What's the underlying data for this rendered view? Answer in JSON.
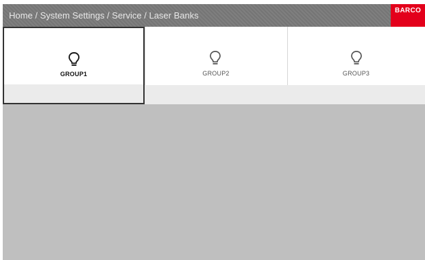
{
  "header": {
    "breadcrumb": "Home / System Settings / Service / Laser Banks",
    "logo_text": "BARCO",
    "logo_color": "#e3001b",
    "background_color": "#7a7a7a"
  },
  "groups": [
    {
      "label": "GROUP1",
      "icon": "lightbulb-icon",
      "selected": true
    },
    {
      "label": "GROUP2",
      "icon": "lightbulb-icon",
      "selected": false
    },
    {
      "label": "GROUP3",
      "icon": "lightbulb-icon",
      "selected": false
    }
  ],
  "colors": {
    "content_background": "#bfbfbf",
    "tile_background": "#ffffff",
    "tile_footer": "#ebebeb",
    "selected_border": "#333333"
  }
}
